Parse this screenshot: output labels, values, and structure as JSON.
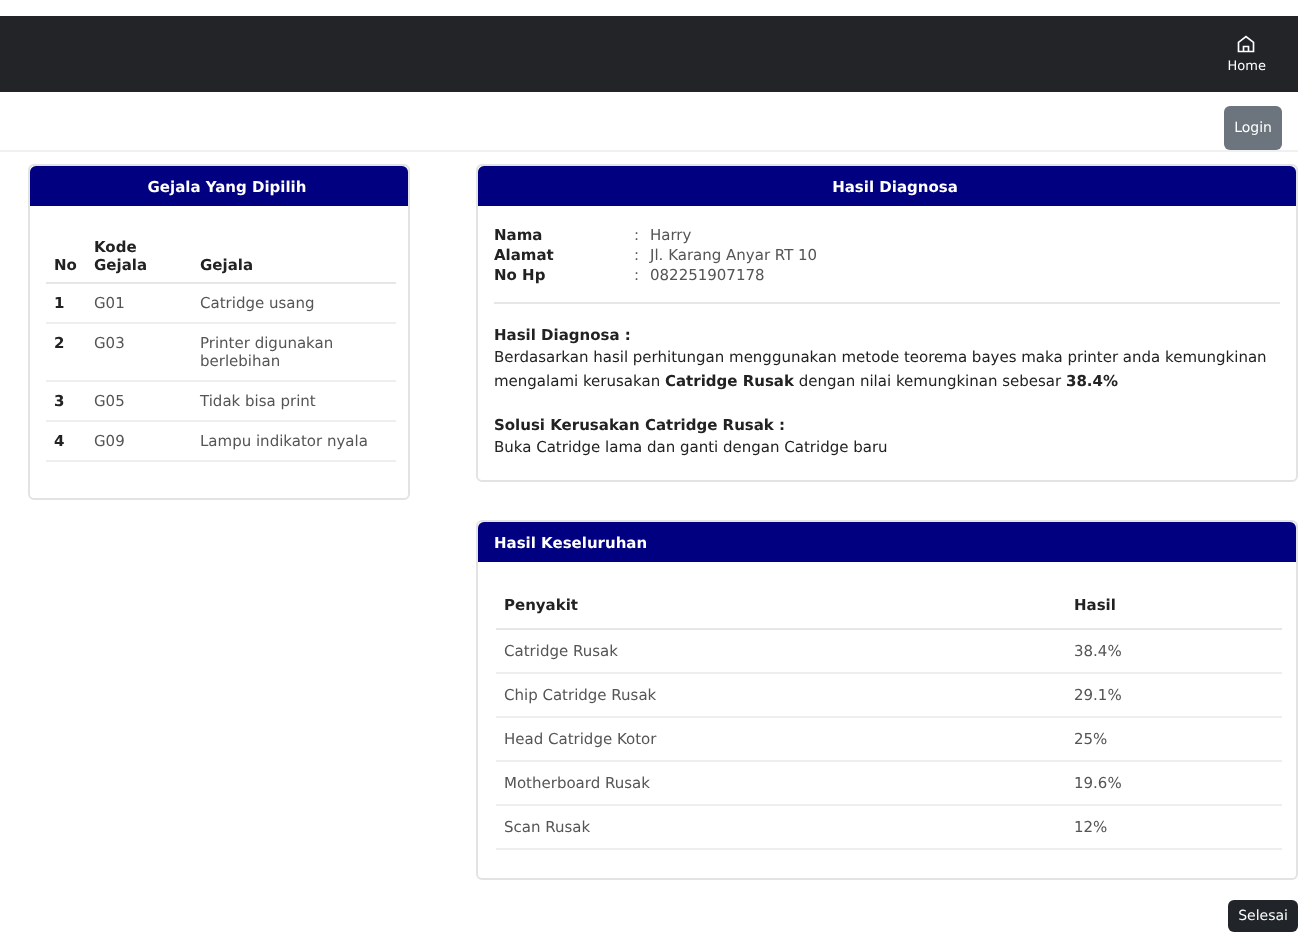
{
  "navbar": {
    "home_label": "Home"
  },
  "login_button": "Login",
  "symptoms_card": {
    "title": "Gejala Yang Dipilih",
    "columns": [
      "No",
      "Kode Gejala",
      "Gejala"
    ],
    "rows": [
      [
        "1",
        "G01",
        "Catridge usang"
      ],
      [
        "2",
        "G03",
        "Printer digunakan berlebihan"
      ],
      [
        "3",
        "G05",
        "Tidak bisa print"
      ],
      [
        "4",
        "G09",
        "Lampu indikator nyala"
      ]
    ]
  },
  "diagnosis_card": {
    "title": "Hasil Diagnosa",
    "fields": [
      {
        "label": "Nama",
        "separator": ":",
        "value": "Harry"
      },
      {
        "label": "Alamat",
        "separator": ":",
        "value": "Jl. Karang Anyar RT 10"
      },
      {
        "label": "No Hp",
        "separator": ":",
        "value": "082251907178"
      }
    ],
    "result_heading": "Hasil Diagnosa :",
    "result_text": "Berdasarkan hasil perhitungan menggunakan metode teorema bayes maka printer anda kemungkinan mengalami kerusakan **Catridge Rusak** dengan nilai kemungkinan sebesar **38.4%**",
    "solution_heading": "Solusi Kerusakan Catridge Rusak :",
    "solution_text": "Buka Catridge lama dan ganti dengan Catridge baru"
  },
  "overall_card": {
    "title": "Hasil Keseluruhan",
    "columns": [
      "Penyakit",
      "Hasil"
    ],
    "rows": [
      [
        "Catridge Rusak",
        "38.4%"
      ],
      [
        "Chip Catridge Rusak",
        "29.1%"
      ],
      [
        "Head Catridge Kotor",
        "25%"
      ],
      [
        "Motherboard Rusak",
        "19.6%"
      ],
      [
        "Scan Rusak",
        "12%"
      ]
    ]
  },
  "finish_button": "Selesai"
}
